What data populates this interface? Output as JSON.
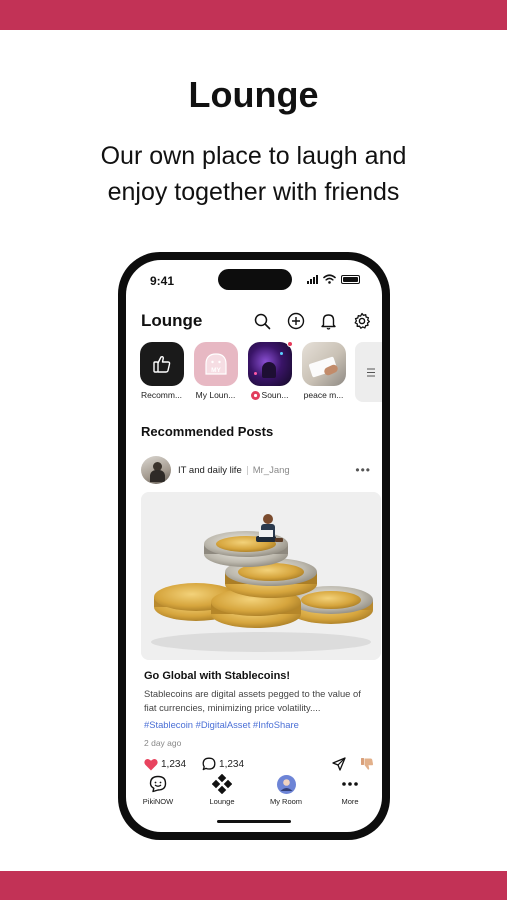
{
  "promo": {
    "title": "Lounge",
    "subtitle_line1": "Our own place to laugh and",
    "subtitle_line2": "enjoy together with friends"
  },
  "status_bar": {
    "time": "9:41"
  },
  "app": {
    "title": "Lounge"
  },
  "top_icons": [
    "search-icon",
    "plus-circle-icon",
    "bell-icon",
    "gear-icon"
  ],
  "stories": [
    {
      "label": "Recomm..."
    },
    {
      "label": "My Loun...",
      "badge": "MY"
    },
    {
      "label": "Soun..."
    },
    {
      "label": "peace m..."
    }
  ],
  "section": {
    "title": "Recommended Posts"
  },
  "post": {
    "board": "IT and daily life",
    "author": "Mr_Jang",
    "title": "Go Global with Stablecoins!",
    "body": "Stablecoins are digital assets pegged to the value of fiat currencies, minimizing price volatility....",
    "tags": "#Stablecoin #DigitalAsset #InfoShare",
    "time": "2 day ago",
    "likes": "1,234",
    "comments": "1,234"
  },
  "bottom_nav": [
    {
      "label": "PikiNOW"
    },
    {
      "label": "Lounge"
    },
    {
      "label": "My Room"
    },
    {
      "label": "More"
    }
  ],
  "colors": {
    "accent": "#c23256",
    "tag": "#4a6fd6",
    "like": "#e8435e"
  }
}
